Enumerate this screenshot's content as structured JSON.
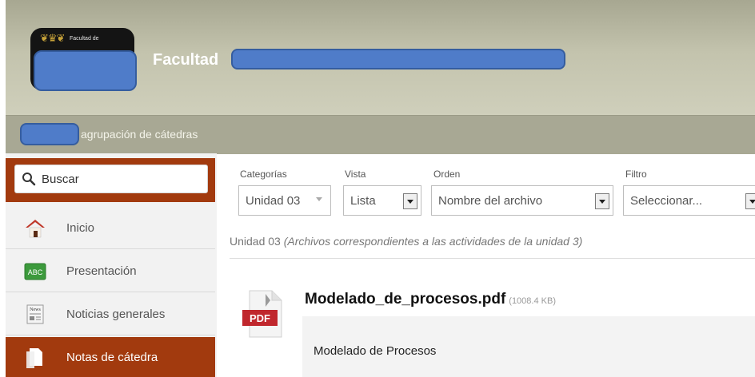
{
  "header": {
    "logo_crest": "❦♛❦",
    "logo_small_text": "Facultad de",
    "faculty_label": "Facultad"
  },
  "subheader": {
    "text": "agrupación de cátedras"
  },
  "search": {
    "placeholder": "Buscar"
  },
  "sidebar": {
    "items": [
      {
        "label": "Inicio",
        "icon": "home-icon"
      },
      {
        "label": "Presentación",
        "icon": "abc-icon",
        "icon_text": "ABC"
      },
      {
        "label": "Noticias generales",
        "icon": "newspaper-icon",
        "icon_text": "News"
      },
      {
        "label": "Notas de cátedra",
        "icon": "document-icon",
        "active": true
      }
    ]
  },
  "filters": {
    "categoria_label": "Categorías",
    "categoria_value": "Unidad 03",
    "vista_label": "Vista",
    "vista_value": "Lista",
    "orden_label": "Orden",
    "orden_value": "Nombre del archivo",
    "filtro_label": "Filtro",
    "filtro_value": "Seleccionar..."
  },
  "folder": {
    "name": "Unidad 03",
    "description": "(Archivos correspondientes a las actividades de la unidad 3)"
  },
  "file": {
    "icon_label": "PDF",
    "name": "Modelado_de_procesos.pdf",
    "size": "(1008.4 KB)",
    "description": "Modelado de Procesos"
  },
  "colors": {
    "accent": "#a23a0e",
    "header_bg": "#c3c3ad",
    "subheader_bg": "#a8a894",
    "redaction": "#4f7cc9"
  }
}
